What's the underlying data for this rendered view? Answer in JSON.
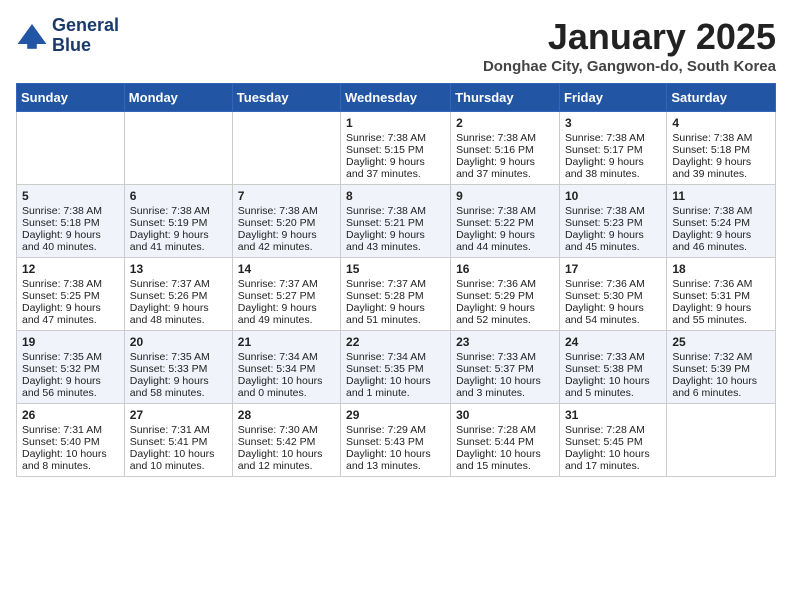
{
  "logo": {
    "line1": "General",
    "line2": "Blue"
  },
  "title": "January 2025",
  "location": "Donghae City, Gangwon-do, South Korea",
  "days_of_week": [
    "Sunday",
    "Monday",
    "Tuesday",
    "Wednesday",
    "Thursday",
    "Friday",
    "Saturday"
  ],
  "weeks": [
    {
      "shaded": false,
      "days": [
        {
          "num": "",
          "content": ""
        },
        {
          "num": "",
          "content": ""
        },
        {
          "num": "",
          "content": ""
        },
        {
          "num": "1",
          "content": "Sunrise: 7:38 AM\nSunset: 5:15 PM\nDaylight: 9 hours\nand 37 minutes."
        },
        {
          "num": "2",
          "content": "Sunrise: 7:38 AM\nSunset: 5:16 PM\nDaylight: 9 hours\nand 37 minutes."
        },
        {
          "num": "3",
          "content": "Sunrise: 7:38 AM\nSunset: 5:17 PM\nDaylight: 9 hours\nand 38 minutes."
        },
        {
          "num": "4",
          "content": "Sunrise: 7:38 AM\nSunset: 5:18 PM\nDaylight: 9 hours\nand 39 minutes."
        }
      ]
    },
    {
      "shaded": true,
      "days": [
        {
          "num": "5",
          "content": "Sunrise: 7:38 AM\nSunset: 5:18 PM\nDaylight: 9 hours\nand 40 minutes."
        },
        {
          "num": "6",
          "content": "Sunrise: 7:38 AM\nSunset: 5:19 PM\nDaylight: 9 hours\nand 41 minutes."
        },
        {
          "num": "7",
          "content": "Sunrise: 7:38 AM\nSunset: 5:20 PM\nDaylight: 9 hours\nand 42 minutes."
        },
        {
          "num": "8",
          "content": "Sunrise: 7:38 AM\nSunset: 5:21 PM\nDaylight: 9 hours\nand 43 minutes."
        },
        {
          "num": "9",
          "content": "Sunrise: 7:38 AM\nSunset: 5:22 PM\nDaylight: 9 hours\nand 44 minutes."
        },
        {
          "num": "10",
          "content": "Sunrise: 7:38 AM\nSunset: 5:23 PM\nDaylight: 9 hours\nand 45 minutes."
        },
        {
          "num": "11",
          "content": "Sunrise: 7:38 AM\nSunset: 5:24 PM\nDaylight: 9 hours\nand 46 minutes."
        }
      ]
    },
    {
      "shaded": false,
      "days": [
        {
          "num": "12",
          "content": "Sunrise: 7:38 AM\nSunset: 5:25 PM\nDaylight: 9 hours\nand 47 minutes."
        },
        {
          "num": "13",
          "content": "Sunrise: 7:37 AM\nSunset: 5:26 PM\nDaylight: 9 hours\nand 48 minutes."
        },
        {
          "num": "14",
          "content": "Sunrise: 7:37 AM\nSunset: 5:27 PM\nDaylight: 9 hours\nand 49 minutes."
        },
        {
          "num": "15",
          "content": "Sunrise: 7:37 AM\nSunset: 5:28 PM\nDaylight: 9 hours\nand 51 minutes."
        },
        {
          "num": "16",
          "content": "Sunrise: 7:36 AM\nSunset: 5:29 PM\nDaylight: 9 hours\nand 52 minutes."
        },
        {
          "num": "17",
          "content": "Sunrise: 7:36 AM\nSunset: 5:30 PM\nDaylight: 9 hours\nand 54 minutes."
        },
        {
          "num": "18",
          "content": "Sunrise: 7:36 AM\nSunset: 5:31 PM\nDaylight: 9 hours\nand 55 minutes."
        }
      ]
    },
    {
      "shaded": true,
      "days": [
        {
          "num": "19",
          "content": "Sunrise: 7:35 AM\nSunset: 5:32 PM\nDaylight: 9 hours\nand 56 minutes."
        },
        {
          "num": "20",
          "content": "Sunrise: 7:35 AM\nSunset: 5:33 PM\nDaylight: 9 hours\nand 58 minutes."
        },
        {
          "num": "21",
          "content": "Sunrise: 7:34 AM\nSunset: 5:34 PM\nDaylight: 10 hours\nand 0 minutes."
        },
        {
          "num": "22",
          "content": "Sunrise: 7:34 AM\nSunset: 5:35 PM\nDaylight: 10 hours\nand 1 minute."
        },
        {
          "num": "23",
          "content": "Sunrise: 7:33 AM\nSunset: 5:37 PM\nDaylight: 10 hours\nand 3 minutes."
        },
        {
          "num": "24",
          "content": "Sunrise: 7:33 AM\nSunset: 5:38 PM\nDaylight: 10 hours\nand 5 minutes."
        },
        {
          "num": "25",
          "content": "Sunrise: 7:32 AM\nSunset: 5:39 PM\nDaylight: 10 hours\nand 6 minutes."
        }
      ]
    },
    {
      "shaded": false,
      "days": [
        {
          "num": "26",
          "content": "Sunrise: 7:31 AM\nSunset: 5:40 PM\nDaylight: 10 hours\nand 8 minutes."
        },
        {
          "num": "27",
          "content": "Sunrise: 7:31 AM\nSunset: 5:41 PM\nDaylight: 10 hours\nand 10 minutes."
        },
        {
          "num": "28",
          "content": "Sunrise: 7:30 AM\nSunset: 5:42 PM\nDaylight: 10 hours\nand 12 minutes."
        },
        {
          "num": "29",
          "content": "Sunrise: 7:29 AM\nSunset: 5:43 PM\nDaylight: 10 hours\nand 13 minutes."
        },
        {
          "num": "30",
          "content": "Sunrise: 7:28 AM\nSunset: 5:44 PM\nDaylight: 10 hours\nand 15 minutes."
        },
        {
          "num": "31",
          "content": "Sunrise: 7:28 AM\nSunset: 5:45 PM\nDaylight: 10 hours\nand 17 minutes."
        },
        {
          "num": "",
          "content": ""
        }
      ]
    }
  ]
}
